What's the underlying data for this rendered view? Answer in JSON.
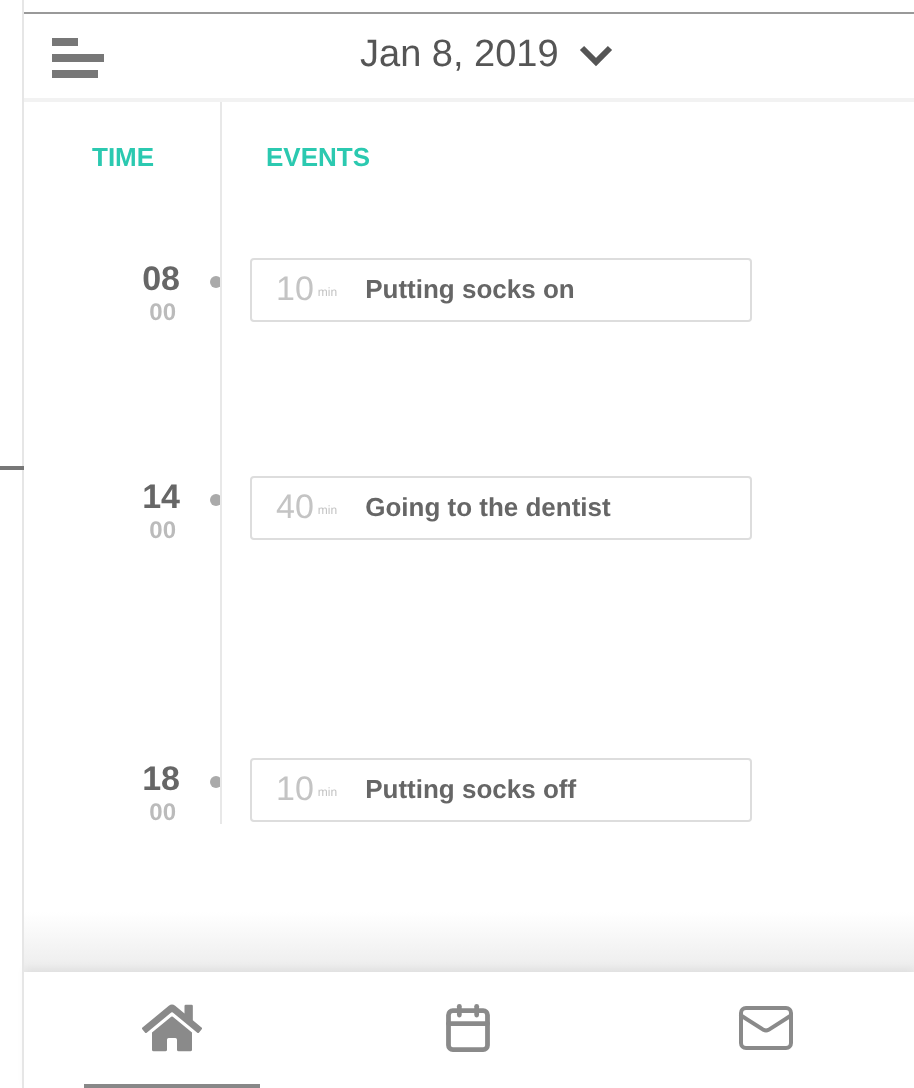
{
  "header": {
    "date": "Jan 8, 2019"
  },
  "columns": {
    "time": "TIME",
    "events": "EVENTS"
  },
  "events": [
    {
      "hour": "08",
      "minute": "00",
      "duration": "10",
      "unit": "min",
      "title": "Putting socks on"
    },
    {
      "hour": "14",
      "minute": "00",
      "duration": "40",
      "unit": "min",
      "title": "Going to the dentist"
    },
    {
      "hour": "18",
      "minute": "00",
      "duration": "10",
      "unit": "min",
      "title": "Putting socks off"
    }
  ],
  "nav": [
    {
      "kind": "home",
      "selected": true
    },
    {
      "kind": "calendar",
      "selected": false
    },
    {
      "kind": "mail",
      "selected": false
    }
  ]
}
